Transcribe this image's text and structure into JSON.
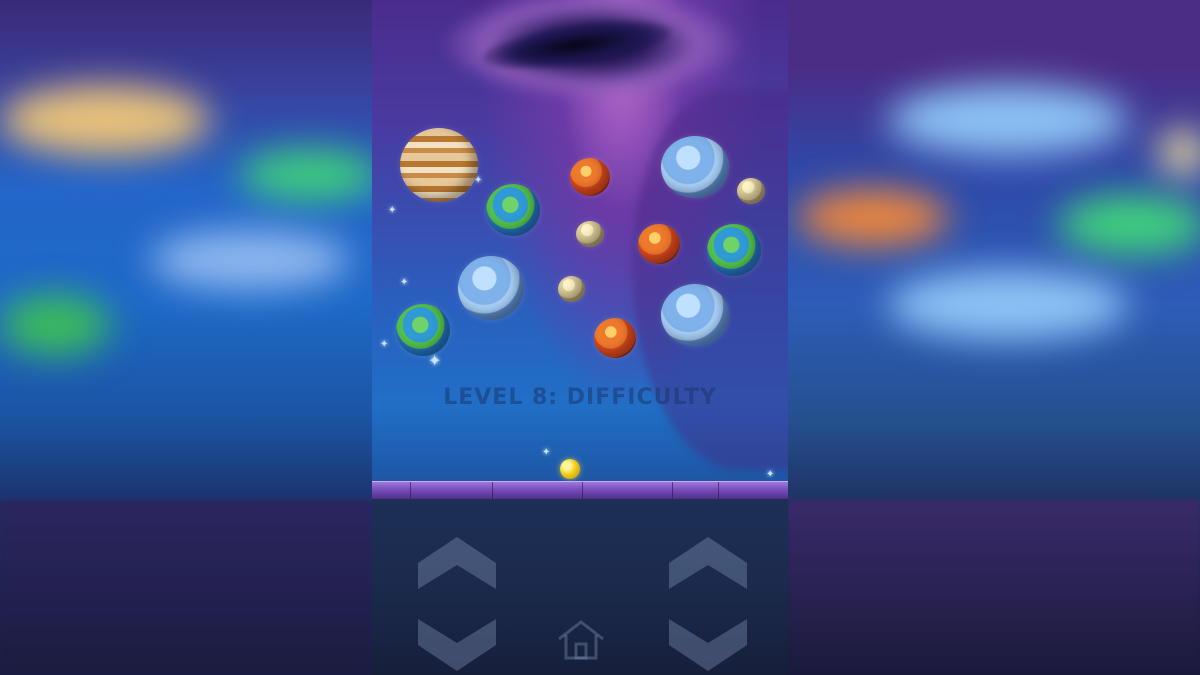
{
  "game": {
    "level_label": "LEVEL 8: DIFFICULTY",
    "planets": [
      {
        "kind": "jupiter",
        "name": "jupiter-planet"
      },
      {
        "kind": "earth",
        "name": "earth-planet"
      },
      {
        "kind": "ice",
        "name": "ice-planet"
      },
      {
        "kind": "mars",
        "name": "mars-planet"
      },
      {
        "kind": "moon",
        "name": "moon-planet"
      }
    ]
  },
  "controls": {
    "left_up": "chevron-up-icon",
    "left_down": "chevron-down-icon",
    "right_up": "chevron-up-icon",
    "right_down": "chevron-down-icon",
    "home": "home-icon"
  },
  "colors": {
    "ball": "#f2cf1c",
    "ground": "#7a4fc0",
    "level_text": "#1e376e"
  }
}
